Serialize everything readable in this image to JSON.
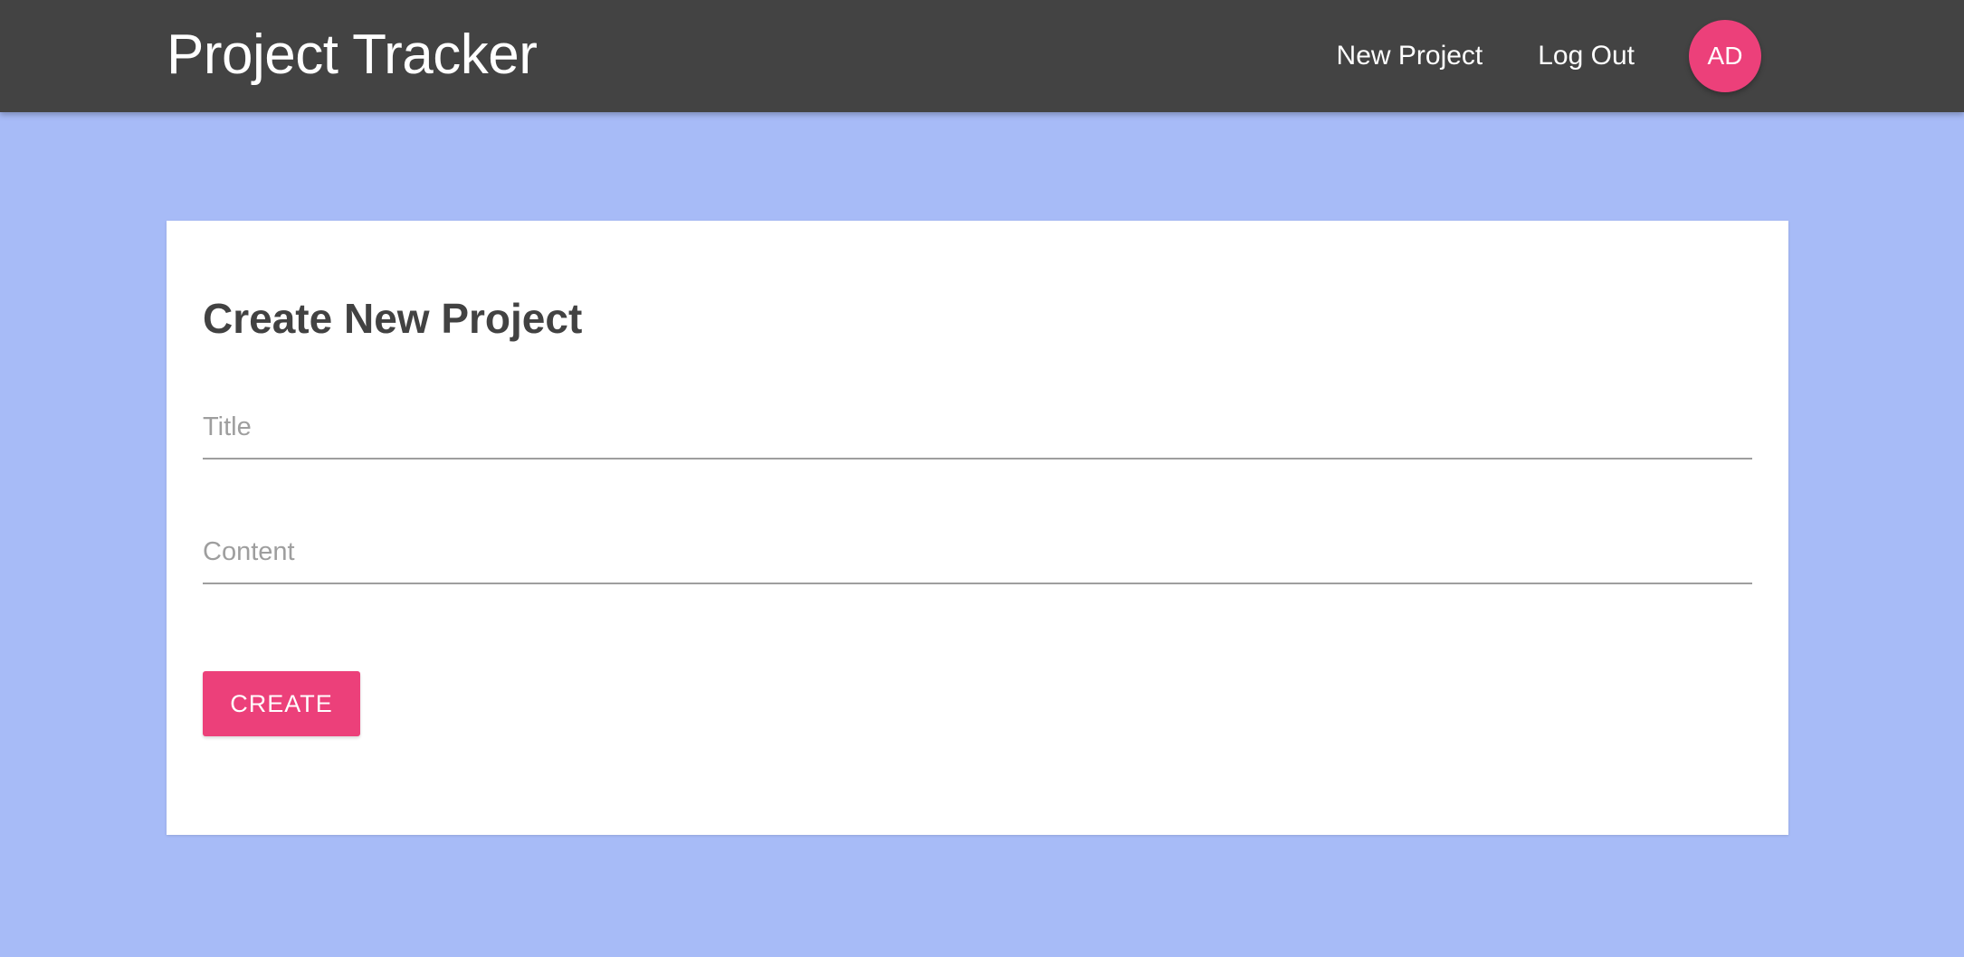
{
  "navbar": {
    "brand": "Project Tracker",
    "links": [
      {
        "label": "New Project"
      },
      {
        "label": "Log Out"
      }
    ],
    "avatar_initials": "AD"
  },
  "form": {
    "heading": "Create New Project",
    "fields": {
      "title": {
        "placeholder": "Title",
        "value": ""
      },
      "content": {
        "placeholder": "Content",
        "value": ""
      }
    },
    "submit_label": "CREATE"
  },
  "colors": {
    "navbar_bg": "#434343",
    "page_bg": "#a7bbf7",
    "accent": "#ec407a",
    "card_bg": "#ffffff"
  }
}
